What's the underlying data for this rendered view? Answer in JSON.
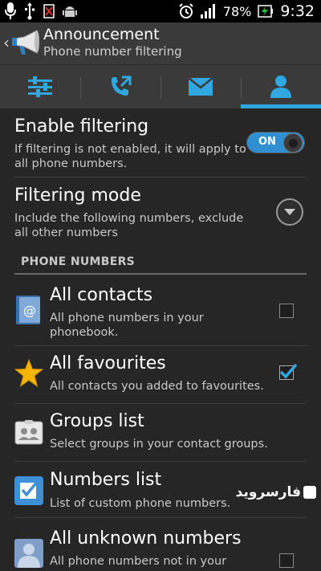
{
  "status_bar": {
    "battery_percent": "78%",
    "time": "9:32",
    "icons": [
      "microphone-icon",
      "usb-icon",
      "sim-off-icon",
      "android-debug-icon",
      "alarm-icon",
      "signal-icon",
      "battery-charging-icon"
    ]
  },
  "action_bar": {
    "title": "Announcement",
    "subtitle": "Phone number filtering",
    "app_icon": "megaphone-icon"
  },
  "tabs": [
    {
      "icon": "sliders-icon",
      "active": false
    },
    {
      "icon": "phone-call-icon",
      "active": false
    },
    {
      "icon": "envelope-icon",
      "active": false
    },
    {
      "icon": "person-icon",
      "active": true
    }
  ],
  "settings": {
    "enable_filtering": {
      "title": "Enable filtering",
      "desc": "If filtering is not enabled, it will apply to all phone numbers.",
      "toggle_label": "ON"
    },
    "filtering_mode": {
      "title": "Filtering mode",
      "desc": "Include the following numbers, exclude all other numbers"
    }
  },
  "section_header": "PHONE NUMBERS",
  "phone_numbers": [
    {
      "title": "All contacts",
      "desc": "All phone numbers in your phonebook.",
      "checked": false,
      "icon": "address-book-icon"
    },
    {
      "title": "All favourites",
      "desc": "All contacts you added to favourites.",
      "checked": true,
      "icon": "star-icon"
    },
    {
      "title": "Groups list",
      "desc": "Select groups in your contact groups.",
      "icon": "groups-card-icon"
    },
    {
      "title": "Numbers list",
      "desc": "List of custom phone numbers.",
      "icon": "numbers-checklist-icon"
    },
    {
      "title": "All unknown numbers",
      "desc": "All phone numbers not in your",
      "checked": false,
      "icon": "unknown-person-icon"
    }
  ],
  "watermark": "فارسروید",
  "colors": {
    "accent": "#31a7df",
    "toggle_on": "#2f8fd1",
    "background": "#262626",
    "bar": "#3a3a3a"
  }
}
